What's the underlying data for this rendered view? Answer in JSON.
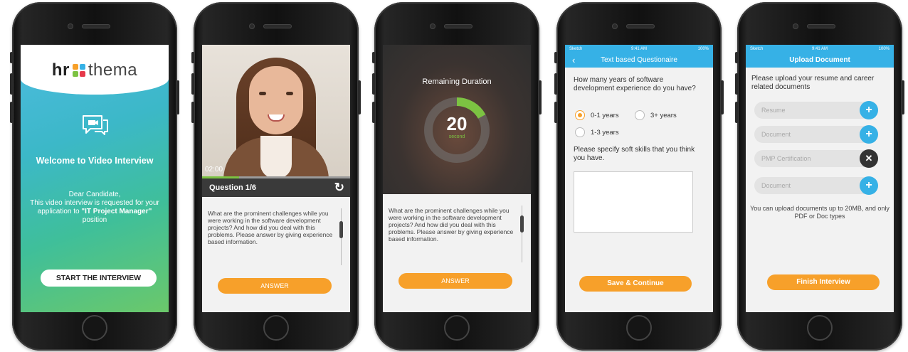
{
  "colors": {
    "accent_orange": "#f7a02a",
    "header_blue": "#36b1e6",
    "progress_green": "#7cc242",
    "dark_bar": "#3a3a3a"
  },
  "welcome": {
    "logo_hr": "hr",
    "logo_thema": "thema",
    "title": "Welcome to Video Interview",
    "greeting": "Dear Candidate,",
    "body": "This video interview is requested for your application to",
    "position": "\"IT Project Manager\"",
    "position_suffix": "position",
    "start_button": "START THE INTERVIEW"
  },
  "question": {
    "elapsed": "02:00",
    "progress": 0.25,
    "label": "Question 1/6",
    "refresh_icon": "refresh-icon",
    "text": "What are the prominent challenges while you were working in the software development projects? And how did you deal with this problems. Please answer by giving experience based information.",
    "answer_button": "ANSWER"
  },
  "countdown": {
    "title": "Remaining Duration",
    "value": "20",
    "unit": "second",
    "fraction": 0.17,
    "text": "What are the prominent challenges while you were working in the software development projects? And how did you deal with this problems. Please answer by giving experience based information.",
    "answer_button": "ANSWER"
  },
  "questionnaire": {
    "status": {
      "left": "Sketch",
      "time": "9:41 AM",
      "right": "100%"
    },
    "title": "Text based Questionaire",
    "q1": "How many years of software development experience do you have?",
    "options": [
      {
        "label": "0-1 years",
        "selected": true
      },
      {
        "label": "3+ years",
        "selected": false
      },
      {
        "label": "1-3 years",
        "selected": false
      }
    ],
    "q2": "Please specify soft skills that you think you have.",
    "answer_value": "",
    "save_button": "Save & Continue"
  },
  "upload": {
    "status": {
      "left": "Sketch",
      "time": "9:41 AM",
      "right": "100%"
    },
    "title": "Upload Document",
    "intro": "Please upload your resume and career related documents",
    "rows": [
      {
        "label": "Resume",
        "action": "add"
      },
      {
        "label": "Document",
        "action": "add"
      },
      {
        "label": "PMP Certification",
        "action": "remove"
      },
      {
        "label": "Document",
        "action": "add"
      }
    ],
    "note": "You can upload documents up to 20MB, and only PDF or Doc types",
    "finish_button": "Finish Interview"
  }
}
